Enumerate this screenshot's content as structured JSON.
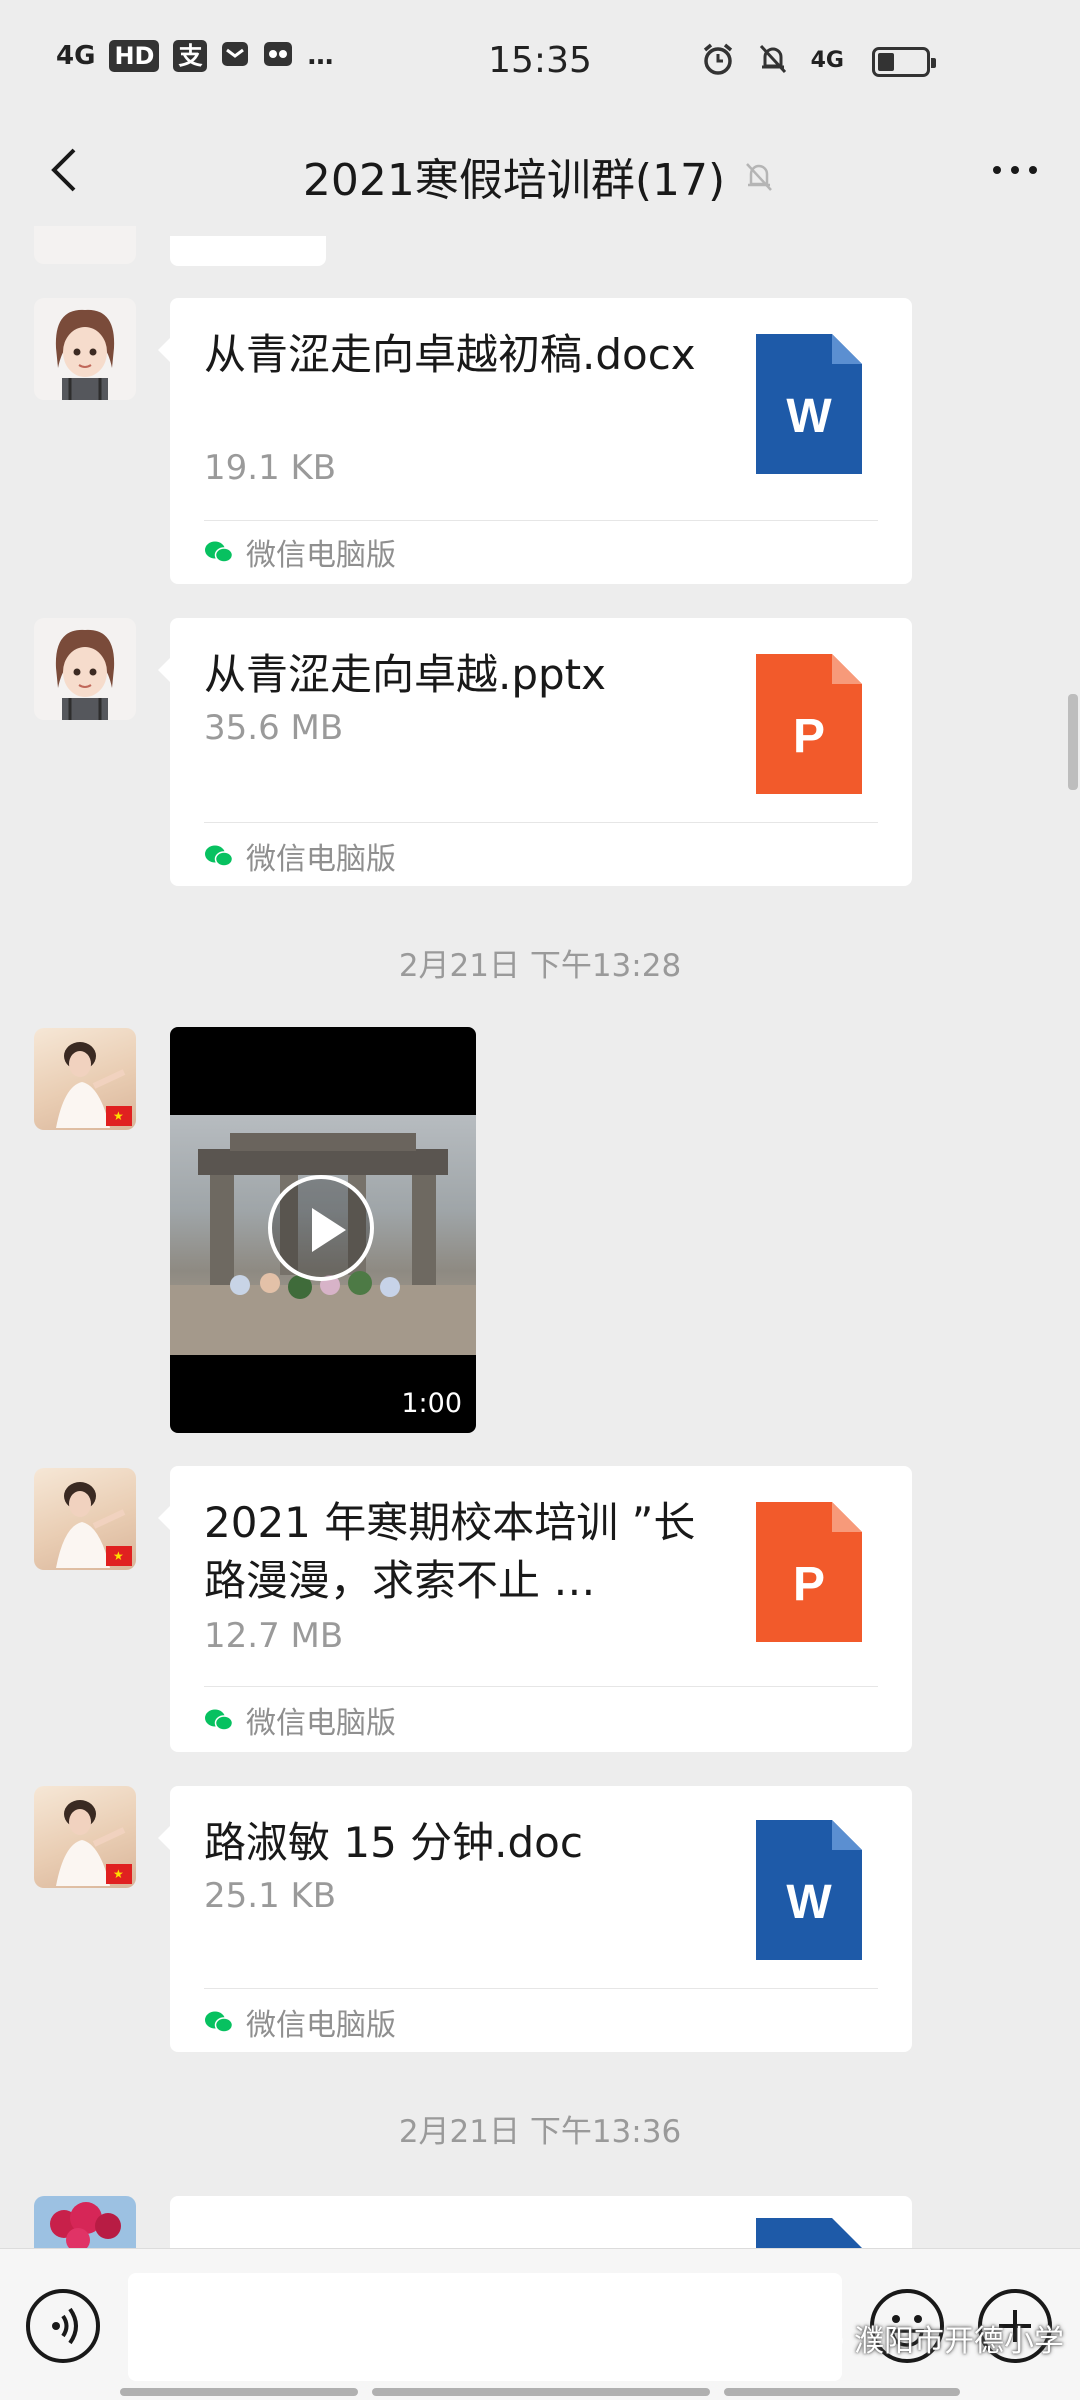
{
  "status_bar": {
    "left_indicators": [
      "4G",
      "HD",
      "支",
      "…"
    ],
    "time": "15:35",
    "network": "4G"
  },
  "nav": {
    "title": "2021寒假培训群(17)"
  },
  "messages": [
    {
      "type": "file",
      "name": "从青涩走向卓越初稿.docx",
      "size": "19.1 KB",
      "source": "微信电脑版",
      "file_icon": "word-icon",
      "icon_letter": "W",
      "color": "#1e5aa8"
    },
    {
      "type": "file",
      "name": "从青涩走向卓越.pptx",
      "size": "35.6 MB",
      "source": "微信电脑版",
      "file_icon": "powerpoint-icon",
      "icon_letter": "P",
      "color": "#f25a2b"
    },
    {
      "type": "timestamp",
      "text": "2月21日 下午13:28"
    },
    {
      "type": "video",
      "duration": "1:00"
    },
    {
      "type": "file",
      "name": "2021 年寒期校本培训 ”长路漫漫，求索不止 …",
      "size": "12.7 MB",
      "source": "微信电脑版",
      "file_icon": "powerpoint-icon",
      "icon_letter": "P",
      "color": "#f25a2b"
    },
    {
      "type": "file",
      "name": "路淑敏 15 分钟.doc",
      "size": "25.1 KB",
      "source": "微信电脑版",
      "file_icon": "word-icon",
      "icon_letter": "W",
      "color": "#1e5aa8"
    },
    {
      "type": "timestamp",
      "text": "2月21日 下午13:36"
    }
  ],
  "watermark": "濮阳市开德小学",
  "colors": {
    "background": "#ededed",
    "word_blue": "#1e5aa8",
    "ppt_orange": "#f25a2b",
    "wechat_green": "#07c160"
  }
}
